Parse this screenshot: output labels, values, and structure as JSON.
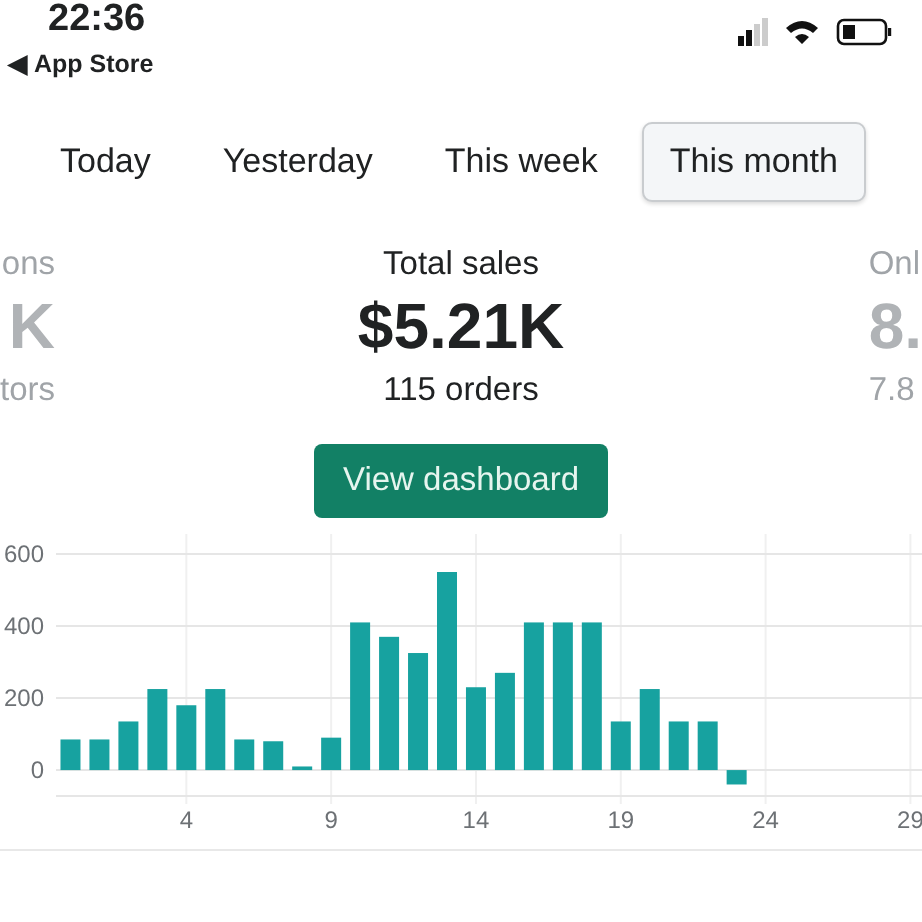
{
  "status_bar": {
    "time": "22:36",
    "back_link": "◀ App Store"
  },
  "tabs": [
    {
      "label": "Today",
      "selected": false
    },
    {
      "label": "Yesterday",
      "selected": false
    },
    {
      "label": "This week",
      "selected": false
    },
    {
      "label": "This month",
      "selected": true
    }
  ],
  "stats": [
    {
      "title": "ons",
      "value": "K",
      "detail": "tors",
      "kind": "side"
    },
    {
      "title": "Total sales",
      "value": "$5.21K",
      "detail": "115 orders",
      "kind": "main"
    },
    {
      "title": "Onl",
      "value": "8.",
      "detail": "7.8",
      "kind": "side"
    }
  ],
  "button": {
    "label": "View dashboard"
  },
  "chart_data": {
    "type": "bar",
    "x": [
      0,
      1,
      2,
      3,
      4,
      5,
      6,
      7,
      8,
      9,
      10,
      11,
      12,
      13,
      14,
      15,
      16,
      17,
      18,
      19,
      20,
      21,
      22,
      23,
      24,
      25,
      26,
      27,
      28,
      29
    ],
    "series": [
      {
        "color": "#17a2a0",
        "values": [
          85,
          85,
          135,
          225,
          180,
          225,
          85,
          80,
          10,
          90,
          410,
          370,
          325,
          550,
          230,
          270,
          410,
          410,
          410,
          135,
          225,
          135,
          135,
          -40,
          0,
          0,
          0,
          0,
          0,
          0
        ]
      }
    ],
    "grid": true,
    "xlim": [
      -0.5,
      29.4
    ],
    "ylim": [
      -72,
      600
    ],
    "yticks": [
      {
        "value": 600,
        "label": "600"
      },
      {
        "value": 400,
        "label": "400"
      },
      {
        "value": 200,
        "label": "200"
      },
      {
        "value": 0,
        "label": "0"
      }
    ],
    "xticks": [
      4,
      9,
      14,
      19,
      24,
      29
    ]
  }
}
